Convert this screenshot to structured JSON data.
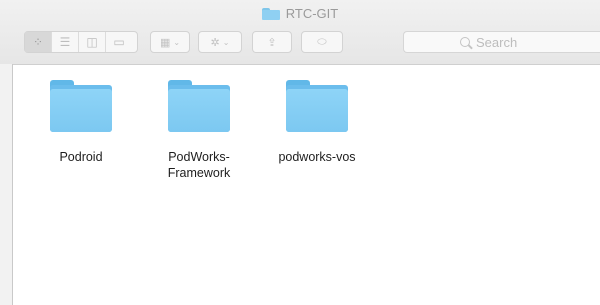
{
  "window": {
    "title": "RTC-GIT"
  },
  "toolbar": {
    "view_buttons": [
      {
        "name": "icon-view",
        "glyph": "⁘",
        "active": true
      },
      {
        "name": "list-view",
        "glyph": "☰",
        "active": false
      },
      {
        "name": "column-view",
        "glyph": "◫",
        "active": false
      },
      {
        "name": "cover-flow-view",
        "glyph": "▭",
        "active": false
      }
    ],
    "arrange_glyph": "▦",
    "action_glyph": "✲",
    "share_glyph": "⇪",
    "tag_glyph": "⬭",
    "caret_glyph": "⌄",
    "search": {
      "placeholder": "Search"
    }
  },
  "items": [
    {
      "label": "Podroid"
    },
    {
      "label": "PodWorks-\nFramework"
    },
    {
      "label": "podworks-vos"
    }
  ],
  "colors": {
    "folder_front": "#8ed4f7",
    "folder_back": "#6bbdec",
    "toolbar_bg": "#e6e6e6"
  }
}
